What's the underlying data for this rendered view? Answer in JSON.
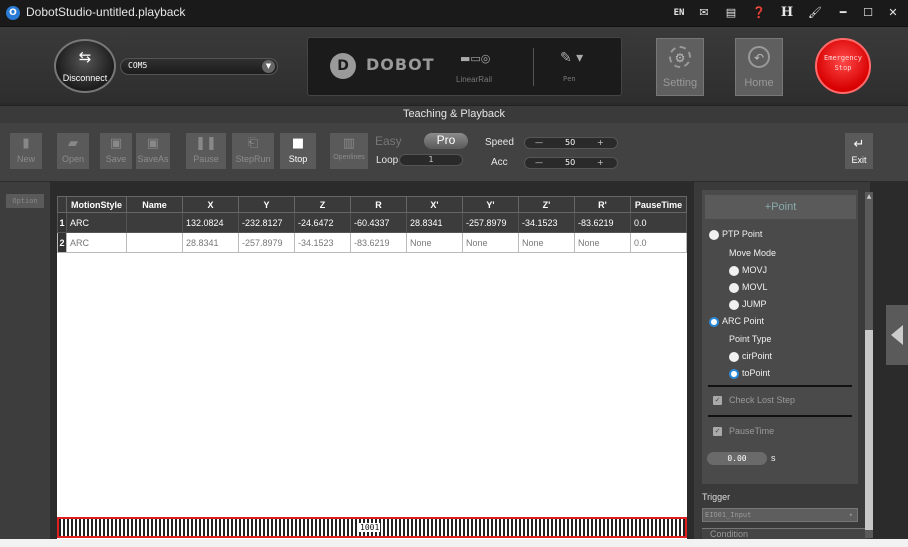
{
  "window": {
    "title": "DobotStudio-untitled.playback",
    "title_icons": [
      "EN",
      "mail-icon",
      "doc-icon",
      "help-icon",
      "H",
      "color-icon",
      "minimize-icon",
      "maximize-icon",
      "close-icon"
    ],
    "title_glyphs": [
      "EN",
      "✉",
      "▤",
      "❓",
      "H",
      "🖌",
      "━",
      "☐",
      "✕"
    ]
  },
  "header": {
    "disconnect_label": "Disconnect",
    "port_value": "COM5",
    "brand": "DOBOT",
    "rail_label": "LinearRail",
    "pen_label": "Pen",
    "setting_label": "Setting",
    "home_label": "Home",
    "estop_label": "Emergency Stop"
  },
  "section_title": "Teaching & Playback",
  "toolbar": {
    "new": "New",
    "open": "Open",
    "save": "Save",
    "saveas": "SaveAs",
    "pause": "Pause",
    "steprun": "StepRun",
    "stop": "Stop",
    "openlines": "Openlines",
    "easy": "Easy",
    "pro": "Pro",
    "loop_label": "Loop",
    "loop_value": "1",
    "speed_label": "Speed",
    "speed_value": "50",
    "acc_label": "Acc",
    "acc_value": "50",
    "minus": "—",
    "plus": "+",
    "exit": "Exit"
  },
  "option_label": "Option",
  "table": {
    "headers": [
      "MotionStyle",
      "Name",
      "X",
      "Y",
      "Z",
      "R",
      "X'",
      "Y'",
      "Z'",
      "R'",
      "PauseTime"
    ],
    "rows": [
      {
        "n": "1",
        "cells": [
          "ARC",
          "",
          "132.0824",
          "-232.8127",
          "-24.6472",
          "-60.4337",
          "28.8341",
          "-257.8979",
          "-34.1523",
          "-83.6219",
          "0.0"
        ]
      },
      {
        "n": "2",
        "cells": [
          "ARC",
          "",
          "28.8341",
          "-257.8979",
          "-34.1523",
          "-83.6219",
          "None",
          "None",
          "None",
          "None",
          "0.0"
        ]
      }
    ],
    "scroll_text": "1001"
  },
  "panel": {
    "add_point": "+Point",
    "ptp_point": "PTP Point",
    "move_mode": "Move Mode",
    "movj": "MOVJ",
    "movl": "MOVL",
    "jump": "JUMP",
    "arc_point": "ARC Point",
    "point_type": "Point Type",
    "cir_point": "cirPoint",
    "to_point": "toPoint",
    "check_lost_step": "Check Lost Step",
    "pause_time": "PauseTime",
    "pause_value": "0.00",
    "pause_unit": "s",
    "trigger": "Trigger",
    "trigger_value": "EIO01_Input",
    "condition": "Condition"
  },
  "colors": {
    "accent_blue": "#2a8ad8",
    "estop_red": "#e00000",
    "highlight_red": "#e02020"
  }
}
